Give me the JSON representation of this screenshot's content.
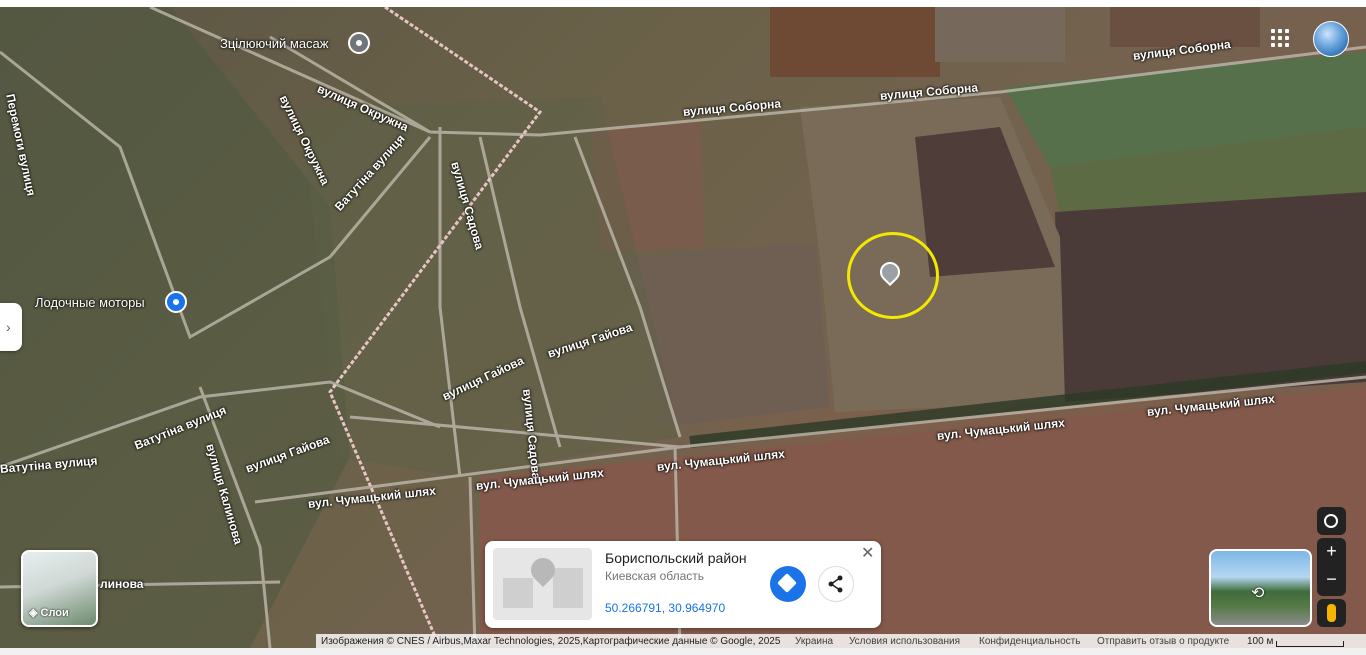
{
  "map": {
    "streets": [
      {
        "id": "okruzhna",
        "text": "вулиця Окружна"
      },
      {
        "id": "okruzhna-v",
        "text": "вулиця Окружна"
      },
      {
        "id": "sobornа-1",
        "text": "вулиця Соборна"
      },
      {
        "id": "sobornа-2",
        "text": "вулиця Соборна"
      },
      {
        "id": "sobornа-3",
        "text": "вулиця Соборна"
      },
      {
        "id": "vatutina-1",
        "text": "Ватутіна вулиця"
      },
      {
        "id": "vatutina-2",
        "text": "Ватутіна вулиця"
      },
      {
        "id": "vatutina-3",
        "text": "Ватутіна вулиця"
      },
      {
        "id": "sadova-1",
        "text": "вулиця Садова"
      },
      {
        "id": "sadova-2",
        "text": "вулиця Садова"
      },
      {
        "id": "gayova-1",
        "text": "вулиця Гайова"
      },
      {
        "id": "gayova-2",
        "text": "вулиця Гайова"
      },
      {
        "id": "gayova-3",
        "text": "вулиця Гайова"
      },
      {
        "id": "kalinova",
        "text": "вулиця Калинова"
      },
      {
        "id": "chum-1",
        "text": "вул. Чумацький шлях"
      },
      {
        "id": "chum-2",
        "text": "вул. Чумацький шлях"
      },
      {
        "id": "chum-3",
        "text": "вул. Чумацький шлях"
      },
      {
        "id": "chum-4",
        "text": "вул. Чумацький шлях"
      },
      {
        "id": "chum-5",
        "text": "вул. Чумацький шлях"
      },
      {
        "id": "peremogy",
        "text": "Перемоги вулиця"
      },
      {
        "id": "linova",
        "text": "линова"
      }
    ],
    "pois": [
      {
        "id": "massage",
        "text": "Зцілюючий масаж",
        "pin": "gray"
      },
      {
        "id": "boats",
        "text": "Лодочные моторы",
        "pin": "blue"
      }
    ],
    "selected_marker": "highlighted location"
  },
  "layers": {
    "label": "Слои"
  },
  "place_card": {
    "title": "Бориспольский район",
    "subtitle": "Киевская область",
    "coordinates": "50.266791, 30.964970",
    "close": "✕"
  },
  "controls": {
    "zoom_in": "+",
    "zoom_out": "−"
  },
  "footer": {
    "imagery": "Изображения © CNES / Airbus,Maxar Technologies, 2025,Картографические данные © Google, 2025",
    "country": "Украина",
    "terms": "Условия использования",
    "privacy": "Конфиденциальность",
    "feedback": "Отправить отзыв о продукте",
    "scale": "100 м"
  },
  "colors": {
    "highlight_ring": "#f2e800",
    "route_line": "#e8c4c4",
    "accent": "#1a73e8"
  }
}
